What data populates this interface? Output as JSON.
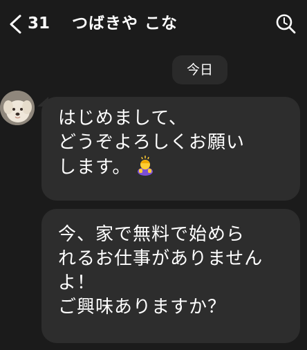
{
  "header": {
    "back_count": "31",
    "title": "つばきや こな",
    "back_icon": "chevron-left-icon",
    "search_icon": "search-icon"
  },
  "date_separator": "今日",
  "messages": [
    {
      "sender": "incoming",
      "lines": [
        "はじめまして、",
        "どうぞよろしくお願い",
        "します。"
      ],
      "emoji": "person-bowing-emoji"
    },
    {
      "sender": "incoming",
      "lines": [
        "今、家で無料で始めら",
        "れるお仕事がありません",
        "よ！",
        "ご興味ありますか？"
      ]
    }
  ],
  "colors": {
    "background": "#1b1b1b",
    "bubble": "#2d2d2d",
    "date_pill": "#2a2a2a",
    "text": "#ffffff"
  }
}
